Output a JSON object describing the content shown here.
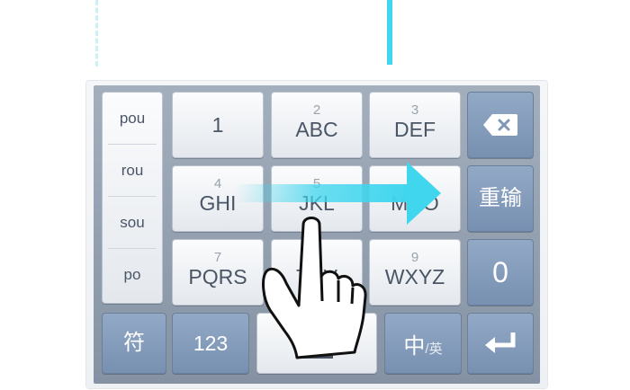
{
  "keyboard": {
    "candidates": [
      "pou",
      "rou",
      "sou",
      "po"
    ],
    "keys": {
      "k1": {
        "main": "1"
      },
      "k2": {
        "sub": "2",
        "main": "ABC"
      },
      "k3": {
        "sub": "3",
        "main": "DEF"
      },
      "k4": {
        "sub": "4",
        "main": "GHI"
      },
      "k5": {
        "sub": "5",
        "main": "JKL"
      },
      "k6": {
        "main": "MNO"
      },
      "k7": {
        "sub": "7",
        "main": "PQRS"
      },
      "k8": {
        "sub": "8",
        "main": "TUV"
      },
      "k9": {
        "sub": "9",
        "main": "WXYZ"
      },
      "reset": {
        "main": "重输"
      },
      "zero": {
        "main": "0"
      },
      "symbol": {
        "main": "符"
      },
      "num123": {
        "main": "123"
      },
      "lang": {
        "zh": "中",
        "en": "/英"
      }
    },
    "icons": {
      "backspace": "backspace-icon",
      "space": "space-icon",
      "enter": "enter-icon",
      "hand": "pointing-hand-icon",
      "arrow": "swipe-arrow-icon"
    }
  },
  "colors": {
    "accent_cyan": "#3fd6ee",
    "key_blue": "#7f97b8",
    "key_light": "#f1f3f6",
    "frame": "#8e9bab"
  }
}
